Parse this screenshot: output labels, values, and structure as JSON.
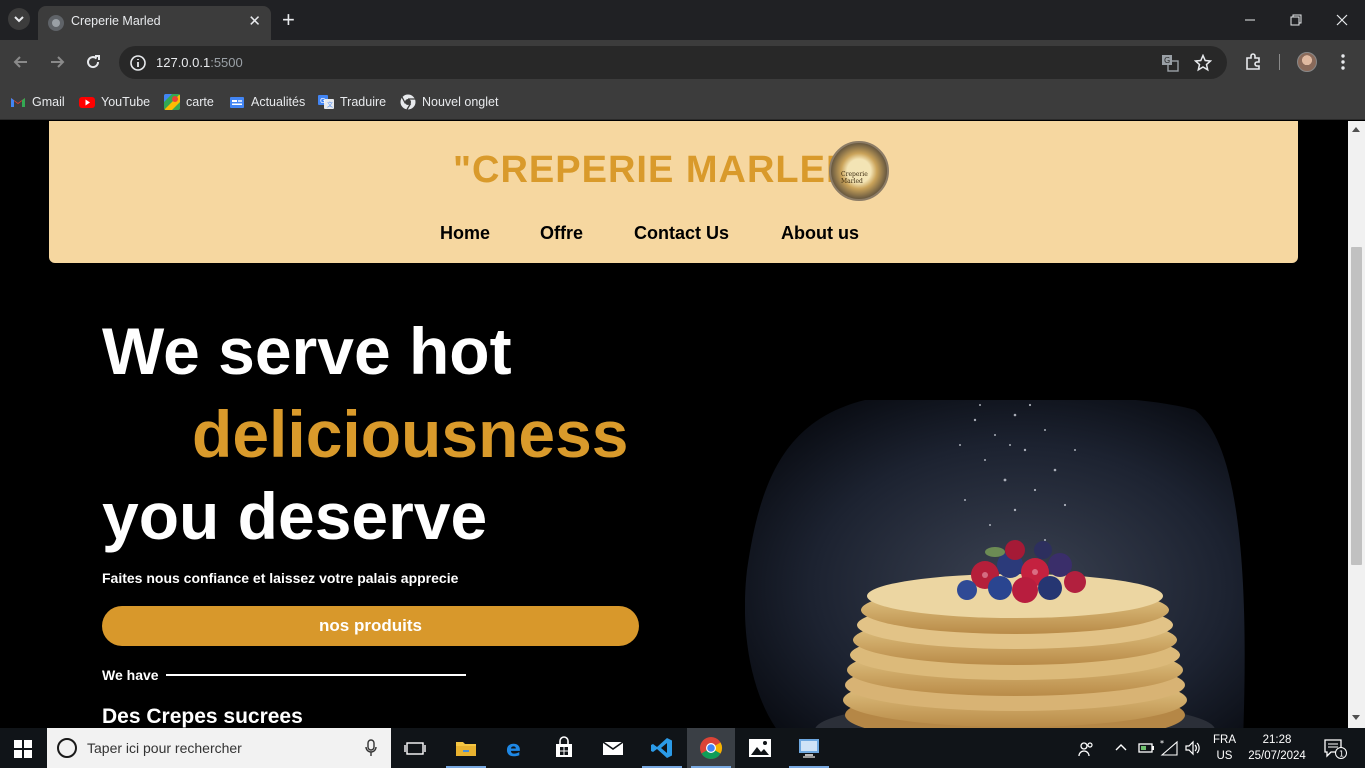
{
  "browser": {
    "tab_title": "Creperie Marled",
    "url_host": "127.0.0.1",
    "url_port": ":5500",
    "bookmarks": [
      {
        "label": "Gmail",
        "icon": "gmail-icon"
      },
      {
        "label": "YouTube",
        "icon": "youtube-icon"
      },
      {
        "label": "carte",
        "icon": "maps-icon"
      },
      {
        "label": "Actualités",
        "icon": "news-icon"
      },
      {
        "label": "Traduire",
        "icon": "translate-icon"
      },
      {
        "label": "Nouvel onglet",
        "icon": "chrome-icon"
      }
    ]
  },
  "site": {
    "brand": "\"CREPERIE MARLED\"",
    "logo_text": "Creperie Marled",
    "nav": [
      "Home",
      "Offre",
      "Contact Us",
      "About us"
    ],
    "hero": {
      "line1": "We serve hot",
      "line2": "deliciousness",
      "line3": "you deserve",
      "tagline": "Faites nous confiance et laissez votre palais apprecie",
      "cta": "nos produits",
      "we_have": "We have",
      "subhead": "Des Crepes sucrees"
    },
    "colors": {
      "accent": "#d99a2b",
      "header_bg": "#f6d7a0",
      "page_bg": "#000000"
    }
  },
  "taskbar": {
    "search_placeholder": "Taper ici pour rechercher",
    "lang_top": "FRA",
    "lang_bottom": "US",
    "time": "21:28",
    "date": "25/07/2024",
    "notifications": "1"
  }
}
